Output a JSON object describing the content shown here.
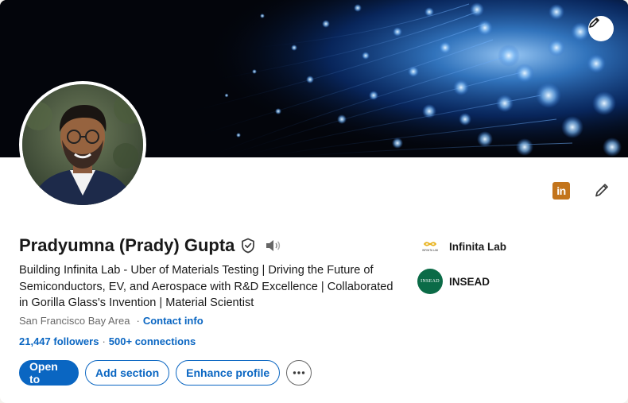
{
  "profile": {
    "name": "Pradyumna (Prady) Gupta",
    "headline": "Building Infinita Lab - Uber of Materials Testing | Driving the Future of Semiconductors, EV, and Aerospace with R&D Excellence | Collaborated in Gorilla Glass's Invention | Material Scientist",
    "location": "San Francisco Bay Area",
    "location_sep": "·",
    "contact_info": "Contact info",
    "followers": "21,447 followers",
    "followers_sep": "·",
    "connections": "500+ connections"
  },
  "actions": {
    "open_to": "Open to",
    "add_section": "Add section",
    "enhance_profile": "Enhance profile"
  },
  "organizations": [
    {
      "name": "Infinita Lab",
      "logo_text": "INFINITA LAB"
    },
    {
      "name": "INSEAD",
      "logo_text": "INSEAD"
    }
  ],
  "badges": {
    "linkedin_badge_text": "in"
  },
  "icons": {
    "banner_edit": "pencil-icon",
    "intro_edit": "pencil-icon",
    "verified": "shield-check-icon",
    "pronounce": "speaker-icon",
    "more": "ellipsis-icon"
  },
  "colors": {
    "brand_blue": "#0a66c2",
    "linkedin_badge": "#c3741b",
    "insead_green": "#0b6b47"
  }
}
